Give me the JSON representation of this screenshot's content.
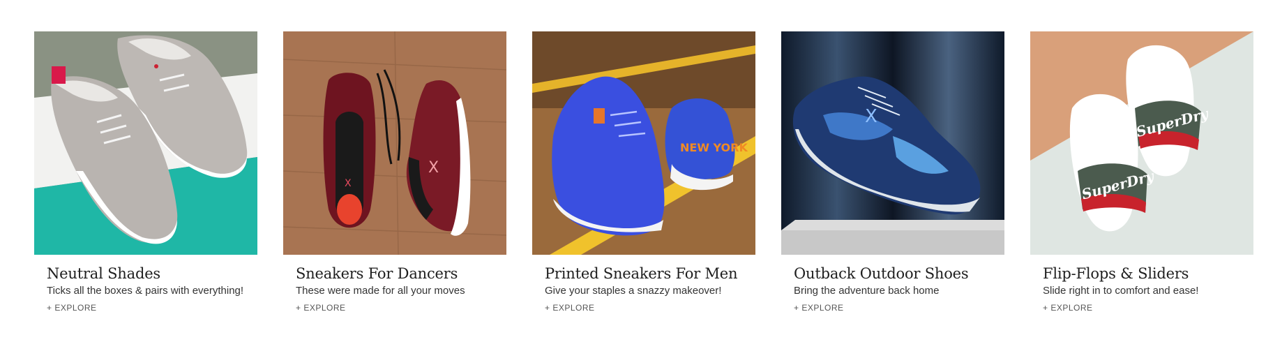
{
  "cards": [
    {
      "title": "Neutral Shades",
      "subtitle": "Ticks all the boxes & pairs with everything!",
      "cta": "+ EXPLORE",
      "image_icon": "grey-canvas-sneakers-image"
    },
    {
      "title": "Sneakers For Dancers",
      "subtitle": "These were made for all your moves",
      "cta": "+ EXPLORE",
      "image_icon": "maroon-mesh-sneakers-image"
    },
    {
      "title": "Printed Sneakers For Men",
      "subtitle": "Give your staples a snazzy makeover!",
      "cta": "+ EXPLORE",
      "image_icon": "blue-court-sneakers-image"
    },
    {
      "title": "Outback Outdoor Shoes",
      "subtitle": "Bring the adventure back home",
      "cta": "+ EXPLORE",
      "image_icon": "navy-trail-shoe-image"
    },
    {
      "title": "Flip-Flops & Sliders",
      "subtitle": "Slide right in to comfort and ease!",
      "cta": "+ EXPLORE",
      "image_icon": "white-sliders-image"
    }
  ],
  "colors": {
    "title": "#1e1e1e",
    "subtitle": "#333333",
    "cta": "#555555"
  }
}
